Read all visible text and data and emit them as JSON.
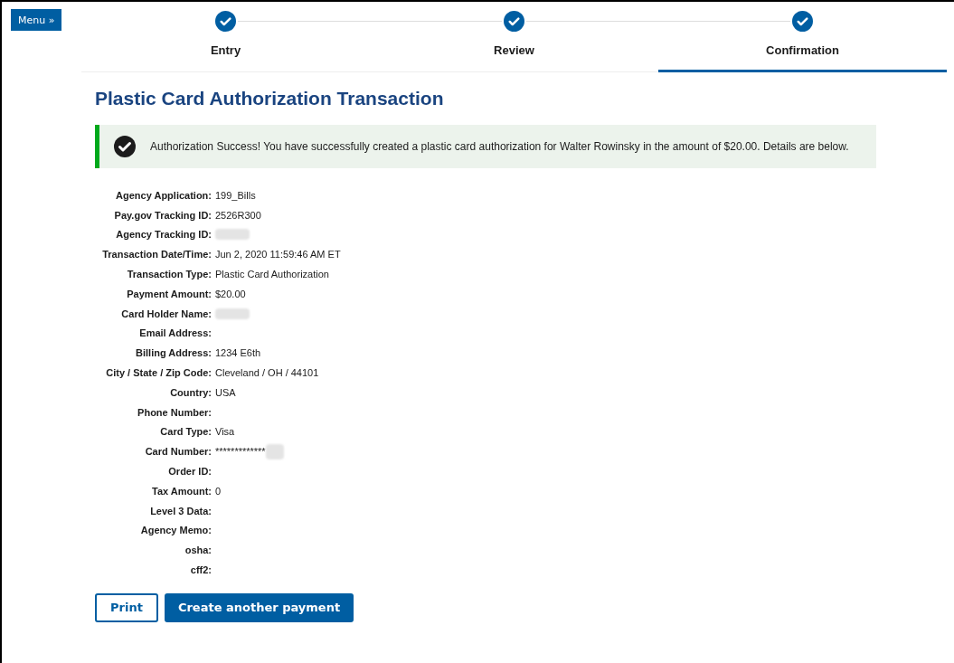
{
  "menu_button": {
    "label": "Menu »"
  },
  "steps": [
    {
      "label": "Entry",
      "completed": true,
      "selected": false
    },
    {
      "label": "Review",
      "completed": true,
      "selected": false
    },
    {
      "label": "Confirmation",
      "completed": true,
      "selected": true
    }
  ],
  "title": "Plastic Card Authorization Transaction",
  "alert": {
    "message": "Authorization Success! You have successfully created a plastic card authorization for Walter Rowinsky in the amount of $20.00. Details are below."
  },
  "details": [
    {
      "label": "Agency Application:",
      "value": "199_Bills"
    },
    {
      "label": "Pay.gov Tracking ID:",
      "value": "2526R300"
    },
    {
      "label": "Agency Tracking ID:",
      "redacted": true
    },
    {
      "label": "Transaction Date/Time:",
      "value": "Jun 2, 2020 11:59:46 AM ET"
    },
    {
      "label": "Transaction Type:",
      "value": "Plastic Card Authorization"
    },
    {
      "label": "Payment Amount:",
      "value": "$20.00"
    },
    {
      "label": "Card Holder Name:",
      "redacted": true
    },
    {
      "label": "Email Address:"
    },
    {
      "label": "Billing Address:",
      "value": "1234 E6th"
    },
    {
      "label": "City / State / Zip Code:",
      "value": "Cleveland / OH / 44101"
    },
    {
      "label": "Country:",
      "value": "USA"
    },
    {
      "label": "Phone Number:"
    },
    {
      "label": "Card Type:",
      "value": "Visa"
    },
    {
      "label": "Card Number:",
      "value": "*************",
      "redacted": true
    },
    {
      "label": "Order ID:"
    },
    {
      "label": "Tax Amount:",
      "value": "0"
    },
    {
      "label": "Level 3 Data:"
    },
    {
      "label": "Agency Memo:"
    },
    {
      "label": "osha:"
    },
    {
      "label": "cff2:"
    }
  ],
  "buttons": [
    {
      "label": "Print",
      "kind": "secondary"
    },
    {
      "label": "Create another payment",
      "kind": "primary"
    }
  ]
}
